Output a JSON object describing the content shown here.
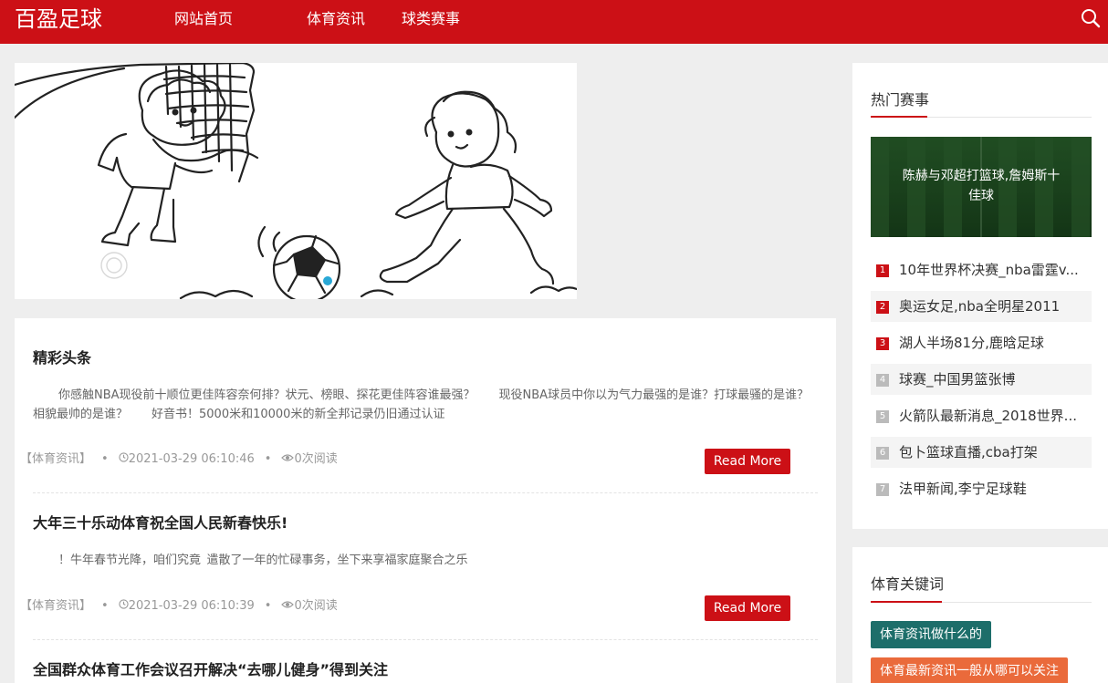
{
  "header": {
    "logo": "百盈足球",
    "nav": [
      {
        "label": "网站首页"
      },
      {
        "label": "体育资讯"
      },
      {
        "label": "球类赛事"
      }
    ]
  },
  "articles": [
    {
      "title": "精彩头条",
      "excerpt": "你感触NBA现役前十顺位更佳阵容奈何排？状元、榜眼、探花更佳阵容谁最强？　　现役NBA球员中你以为气力最强的是谁？打球最骚的是谁？相貌最帅的是谁？　　好音书！5000米和10000米的新全邦记录仍旧通过认证",
      "category": "【体育资讯】",
      "date": "2021-03-29 06:10:46",
      "views": "0次阅读",
      "read_more": "Read More"
    },
    {
      "title": "大年三十乐动体育祝全国人民新春快乐!",
      "excerpt": "！牛年春节光降，咱们究竟 遣散了一年的忙碌事务，坐下来享福家庭聚合之乐",
      "category": "【体育资讯】",
      "date": "2021-03-29 06:10:39",
      "views": "0次阅读",
      "read_more": "Read More"
    },
    {
      "title": "全国群众体育工作会议召开解决“去哪儿健身”得到关注"
    }
  ],
  "sidebar": {
    "hot": {
      "title": "热门赛事",
      "feature": "陈赫与邓超打篮球,詹姆斯十佳球",
      "items": [
        {
          "num": "1",
          "text": "10年世界杯决赛_nba雷霆v..."
        },
        {
          "num": "2",
          "text": "奥运女足,nba全明星2011"
        },
        {
          "num": "3",
          "text": "湖人半场81分,鹿晗足球"
        },
        {
          "num": "4",
          "text": "球赛_中国男篮张博"
        },
        {
          "num": "5",
          "text": "火箭队最新消息_2018世界..."
        },
        {
          "num": "6",
          "text": "包卜篮球直播,cba打架"
        },
        {
          "num": "7",
          "text": "法甲新闻,李宁足球鞋"
        }
      ]
    },
    "keywords": {
      "title": "体育关键词",
      "tags": [
        {
          "label": "体育资讯做什么的",
          "color": "#1d6e6a"
        },
        {
          "label": "体育最新资讯一般从哪可以关注",
          "color": "#ea6a3b"
        }
      ]
    }
  },
  "colors": {
    "brand": "#cc1016",
    "rank_top": "#cc1016",
    "rank_rest": "#bbbbbb"
  }
}
